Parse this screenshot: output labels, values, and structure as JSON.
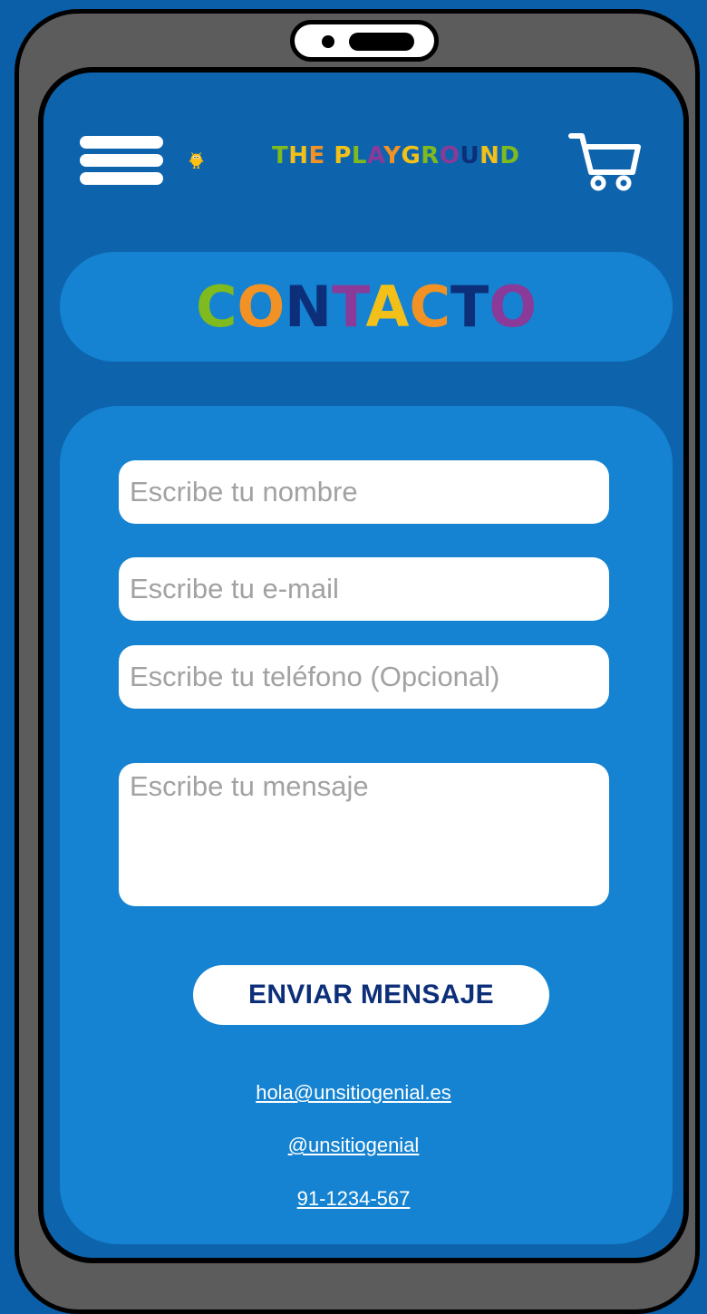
{
  "header": {
    "menu_icon": "hamburger-menu-icon",
    "logo_name": "monster-logo-icon",
    "logo_text": "THE PLAYGROUND",
    "cart_icon": "shopping-cart-icon"
  },
  "title": {
    "letters": [
      {
        "char": "C",
        "color": "#7fba1e"
      },
      {
        "char": "O",
        "color": "#f29224"
      },
      {
        "char": "N",
        "color": "#0d2f7a"
      },
      {
        "char": "T",
        "color": "#8a3a98"
      },
      {
        "char": "A",
        "color": "#f2c019"
      },
      {
        "char": "C",
        "color": "#f29224"
      },
      {
        "char": "T",
        "color": "#0d2f7a"
      },
      {
        "char": "O",
        "color": "#8a3a98"
      }
    ]
  },
  "form": {
    "name_placeholder": "Escribe tu nombre",
    "email_placeholder": "Escribe tu e-mail",
    "phone_placeholder": "Escribe tu teléfono (Opcional)",
    "message_placeholder": "Escribe tu mensaje",
    "submit_label": "ENVIAR MENSAJE"
  },
  "contact": {
    "email": "hola@unsitiogenial.es",
    "social": "@unsitiogenial",
    "phone": "91-1234-567"
  },
  "colors": {
    "background": "#0b5fa8",
    "screen": "#0d64ad",
    "card": "#1583d1",
    "button_text": "#0d2f7a"
  }
}
